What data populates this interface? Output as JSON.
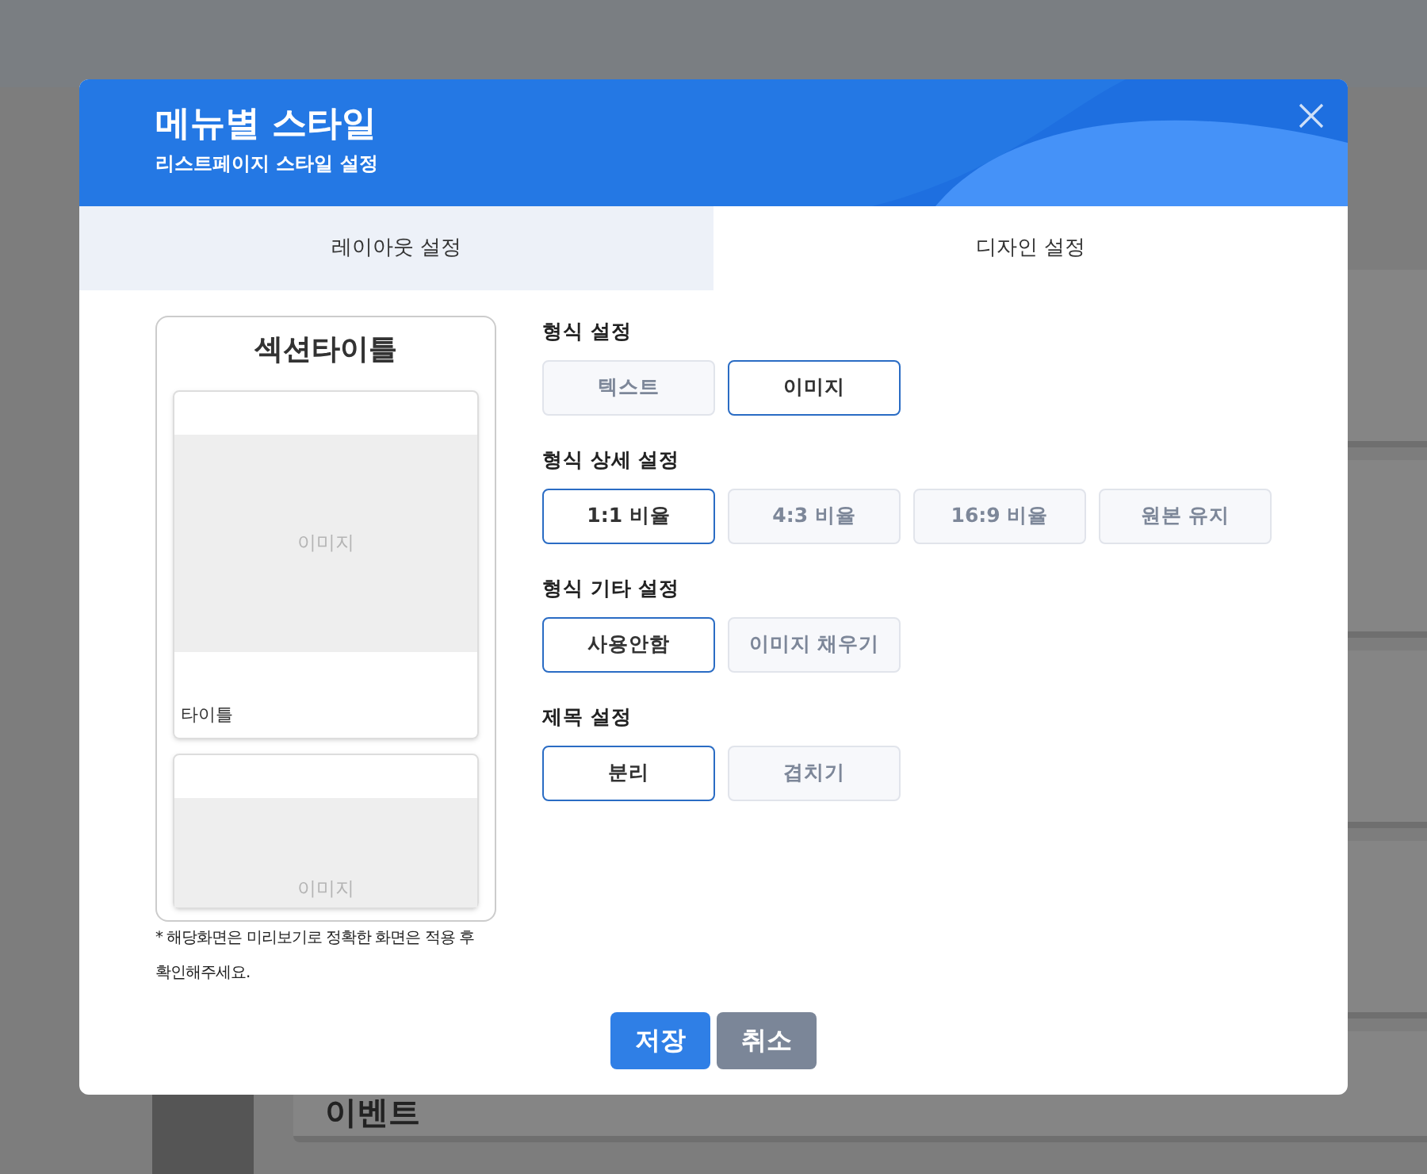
{
  "background": {
    "card_title": "이벤트"
  },
  "header": {
    "title": "메뉴별 스타일",
    "subtitle": "리스트페이지 스타일 설정"
  },
  "tabs": [
    {
      "label": "레이아웃 설정",
      "selected": false
    },
    {
      "label": "디자인 설정",
      "selected": true
    }
  ],
  "preview": {
    "title": "섹션타이틀",
    "cards": [
      {
        "image_label": "이미지",
        "caption": "타이틀"
      },
      {
        "image_label": "이미지"
      }
    ],
    "note": "* 해당화면은 미리보기로 정확한 화면은 적용 후 확인해주세요."
  },
  "settings": [
    {
      "label": "형식 설정",
      "options": [
        {
          "label": "텍스트",
          "selected": false
        },
        {
          "label": "이미지",
          "selected": true
        }
      ]
    },
    {
      "label": "형식 상세 설정",
      "options": [
        {
          "label": "1:1 비율",
          "selected": true
        },
        {
          "label": "4:3 비율",
          "selected": false
        },
        {
          "label": "16:9 비율",
          "selected": false
        },
        {
          "label": "원본 유지",
          "selected": false
        }
      ]
    },
    {
      "label": "형식 기타 설정",
      "options": [
        {
          "label": "사용안함",
          "selected": true
        },
        {
          "label": "이미지 채우기",
          "selected": false
        }
      ]
    },
    {
      "label": "제목 설정",
      "options": [
        {
          "label": "분리",
          "selected": true
        },
        {
          "label": "겹치기",
          "selected": false
        }
      ]
    }
  ],
  "buttons": [
    {
      "label": "저장",
      "kind": "primary"
    },
    {
      "label": "취소",
      "kind": "secondary"
    }
  ]
}
